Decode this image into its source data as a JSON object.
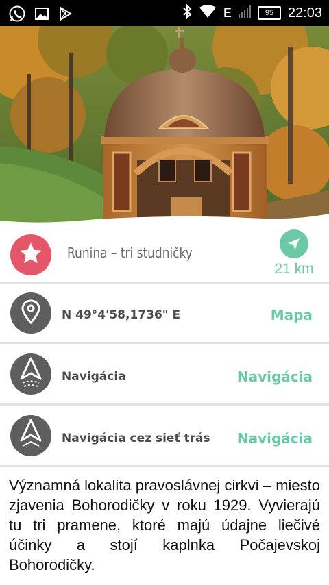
{
  "status_bar": {
    "network": "E",
    "battery": "95",
    "time": "22:03",
    "icons": [
      "whatsapp-icon",
      "image-icon",
      "play-store-icon",
      "bluetooth-icon",
      "wifi-icon",
      "signal-icon",
      "battery-icon"
    ]
  },
  "place": {
    "title": "Runina – tri studničky",
    "distance": "21 km"
  },
  "coordinates": {
    "text": "N 49°4'58,1736\" E",
    "action": "Mapa"
  },
  "navigation": {
    "label": "Navigácia",
    "action": "Navigácia"
  },
  "trail_navigation": {
    "label": "Navigácia cez sieť trás",
    "action": "Navigácia"
  },
  "description": "Významná lokalita pravoslávnej cirkvi – miesto zjavenia Bohorodičky v roku 1929. Vyvierajú tu tri pramene, ktoré majú údajne liečivé účinky a stojí kaplnka Počajevskoj Bohorodičky.",
  "colors": {
    "accent": "#6cc9a5",
    "star_circle": "#e4566a",
    "icon_circle": "#5e5e5e"
  }
}
